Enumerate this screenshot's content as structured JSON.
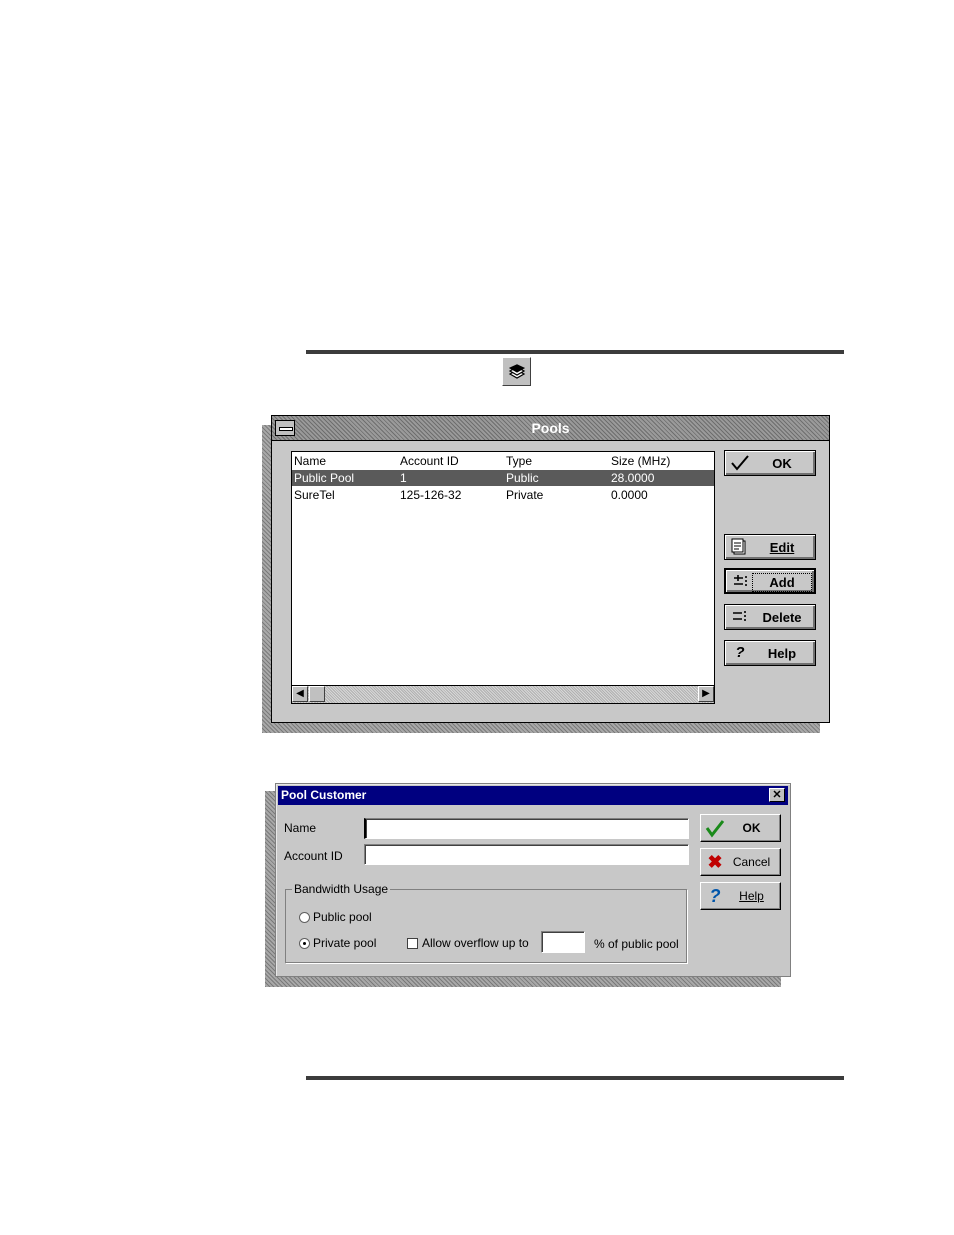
{
  "pools_window": {
    "title": "Pools",
    "columns": [
      "Name",
      "Account ID",
      "Type",
      "Size (MHz)"
    ],
    "rows": [
      [
        "Public Pool",
        "1",
        "Public",
        "28.0000"
      ],
      [
        "SureTel",
        "125-126-32",
        "Private",
        "0.0000"
      ]
    ],
    "selected_row": 0,
    "buttons": {
      "ok": "OK",
      "edit": "Edit",
      "add": "Add",
      "delete": "Delete",
      "help": "Help"
    },
    "icons": {
      "ok": "checkmark-icon",
      "edit": "edit-document-icon",
      "add": "add-item-icon",
      "delete": "delete-item-icon",
      "help": "question-icon"
    }
  },
  "toolbar_icon": "pools-stack-icon",
  "customer_dialog": {
    "title": "Pool Customer",
    "name_label": "Name",
    "name_value": "",
    "account_label": "Account ID",
    "account_value": "",
    "group_label": "Bandwidth Usage",
    "radio_public": "Public pool",
    "radio_private": "Private pool",
    "selected_radio": "private",
    "overflow_label": "Allow overflow up to",
    "overflow_checked": false,
    "overflow_value": "",
    "overflow_suffix": "% of public pool",
    "buttons": {
      "ok": "OK",
      "cancel": "Cancel",
      "help": "Help"
    }
  },
  "colors": {
    "dialog_face": "#c8c8c8",
    "active_title": "#000080",
    "selection": "#5a5a5a",
    "ok_check": "#1a8a1a",
    "cancel_x": "#c00000",
    "help_q": "#0055aa"
  }
}
